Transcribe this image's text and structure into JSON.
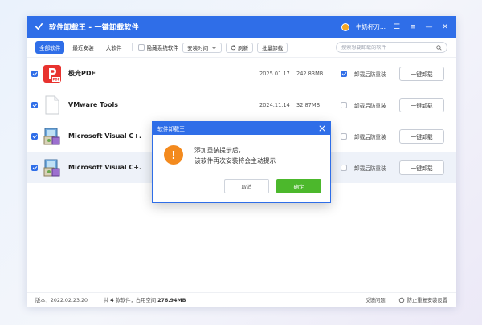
{
  "window": {
    "title": "软件卸载王 - 一键卸载软件",
    "user_name": "牛奶杯刀...",
    "controls": {
      "skin": "☰",
      "menu": "≡",
      "minimize": "—",
      "close": "✕"
    },
    "brand_color": "#2f6ee8"
  },
  "toolbar": {
    "tabs": [
      {
        "label": "全部软件",
        "active": true
      },
      {
        "label": "最近安装",
        "active": false
      },
      {
        "label": "大软件",
        "active": false
      }
    ],
    "hide_system_label": "隐藏系统软件",
    "hide_system_checked": false,
    "sort_label": "安装时间",
    "refresh_label": "刷新",
    "batch_label": "批量卸载",
    "search_placeholder": "搜索想要卸载的软件"
  },
  "software_list": [
    {
      "name": "极光PDF",
      "icon": "pdf-icon",
      "date": "2025.01.17",
      "size": "242.83MB",
      "checked": true,
      "reinstall_label": "卸载后防重装",
      "reinstall_checked": true,
      "uninstall_label": "一键卸载"
    },
    {
      "name": "VMware Tools",
      "icon": "file-icon",
      "date": "2024.11.14",
      "size": "32.87MB",
      "checked": true,
      "reinstall_label": "卸载后防重装",
      "reinstall_checked": false,
      "uninstall_label": "一键卸载"
    },
    {
      "name": "Microsoft Visual C+...",
      "icon": "installer-icon",
      "date": "",
      "size": "",
      "checked": true,
      "reinstall_label": "卸载后防重装",
      "reinstall_checked": false,
      "uninstall_label": "一键卸载"
    },
    {
      "name": "Microsoft Visual C+...",
      "icon": "installer-icon",
      "date": "",
      "size": "",
      "checked": true,
      "reinstall_label": "卸载后防重装",
      "reinstall_checked": false,
      "uninstall_label": "一键卸载"
    }
  ],
  "status": {
    "version": "版本：2022.02.23.20",
    "summary_prefix": "共",
    "count": "4",
    "summary_mid": "款软件，占用空间",
    "space": "276.94MB",
    "feedback": "反馈问题",
    "prevent_label": "防止重复安装设置"
  },
  "dialog": {
    "title": "软件卸载王",
    "line1": "添加重装提示后，",
    "line2": "该软件再次安装将会主动提示",
    "cancel_label": "取消",
    "ok_label": "确定",
    "warn_glyph": "!",
    "ok_color": "#4cb82c",
    "warn_color": "#f38a1e"
  }
}
